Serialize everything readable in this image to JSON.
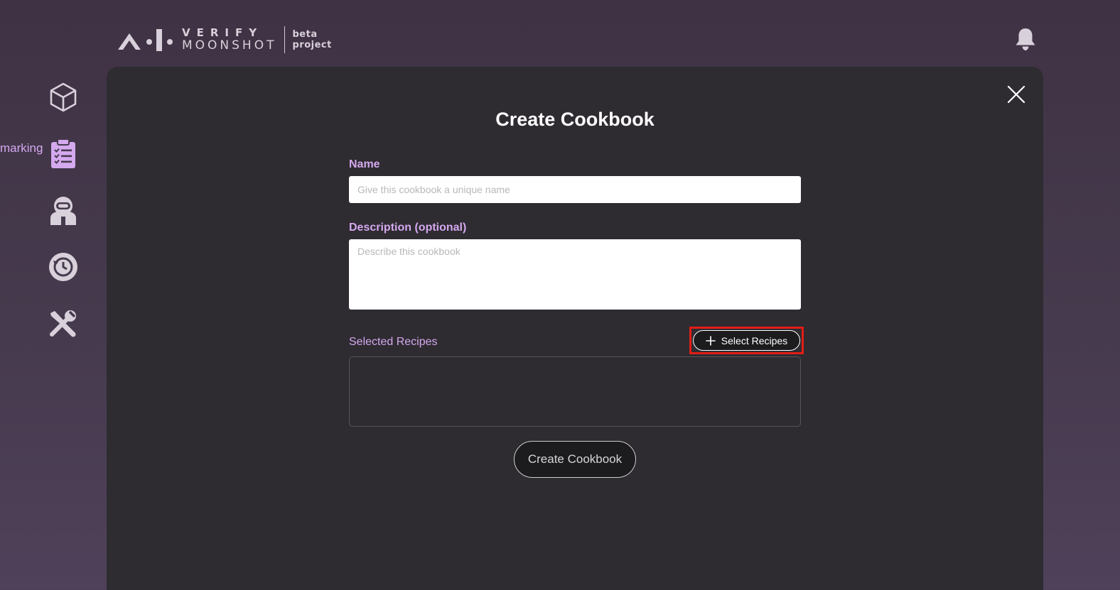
{
  "header": {
    "logo_line1": "VERIFY",
    "logo_line2": "MOONSHOT",
    "logo_sub1": "beta",
    "logo_sub2": "project",
    "logo_icon": "aiverify-mark-icon",
    "notification_icon": "bell-icon"
  },
  "sidebar": {
    "items": [
      {
        "icon": "cube-icon"
      },
      {
        "icon": "clipboard-checklist-icon",
        "label": "marking"
      },
      {
        "icon": "astronaut-icon"
      },
      {
        "icon": "history-clock-icon"
      },
      {
        "icon": "tools-icon"
      }
    ]
  },
  "modal": {
    "title": "Create Cookbook",
    "close_icon": "close-icon",
    "name_label": "Name",
    "name_placeholder": "Give this cookbook a unique name",
    "name_value": "",
    "description_label": "Description (optional)",
    "description_placeholder": "Describe this cookbook",
    "description_value": "",
    "selected_recipes_label": "Selected Recipes",
    "select_recipes_button": "Select Recipes",
    "create_button": "Create Cookbook"
  },
  "colors": {
    "background": "#463a4e",
    "modal": "#2e2b31",
    "accent": "#d4a9ee",
    "highlight": "#e11d16"
  }
}
